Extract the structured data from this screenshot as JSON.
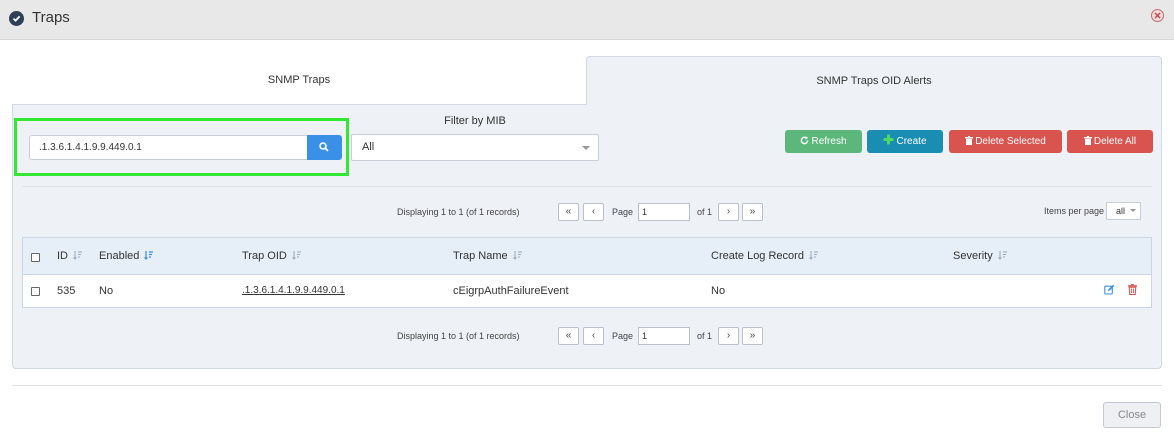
{
  "window": {
    "title": "Traps"
  },
  "tabs": [
    {
      "label": "SNMP Traps",
      "active": false
    },
    {
      "label": "SNMP Traps OID Alerts",
      "active": true
    }
  ],
  "search": {
    "value": ".1.3.6.1.4.1.9.9.449.0.1"
  },
  "filter": {
    "label": "Filter by MIB",
    "selected": "All"
  },
  "toolbar": {
    "refresh_label": "Refresh",
    "create_label": "Create",
    "delete_selected_label": "Delete Selected",
    "delete_all_label": "Delete All"
  },
  "pager": {
    "display_text": "Displaying 1 to 1 (of 1 records)",
    "first": "«",
    "prev": "‹",
    "page_label": "Page",
    "page_value": "1",
    "of_label": "of 1",
    "next": "›",
    "last": "»",
    "items_per_page_label": "Items per page",
    "items_per_page_value": "all"
  },
  "table": {
    "columns": {
      "id": "ID",
      "enabled": "Enabled",
      "trap_oid": "Trap OID",
      "trap_name": "Trap Name",
      "create_log_record": "Create Log Record",
      "severity": "Severity"
    },
    "rows": [
      {
        "id": "535",
        "enabled": "No",
        "trap_oid": ".1.3.6.1.4.1.9.9.449.0.1",
        "trap_name": "cEigrpAuthFailureEvent",
        "create_log_record": "No",
        "severity": ""
      }
    ]
  },
  "footer": {
    "close_label": "Close"
  },
  "colors": {
    "refresh": "#5cb87a",
    "create": "#1a8db3",
    "delete": "#d9534f",
    "search_button": "#3a8fe6",
    "highlight": "#33e833"
  }
}
